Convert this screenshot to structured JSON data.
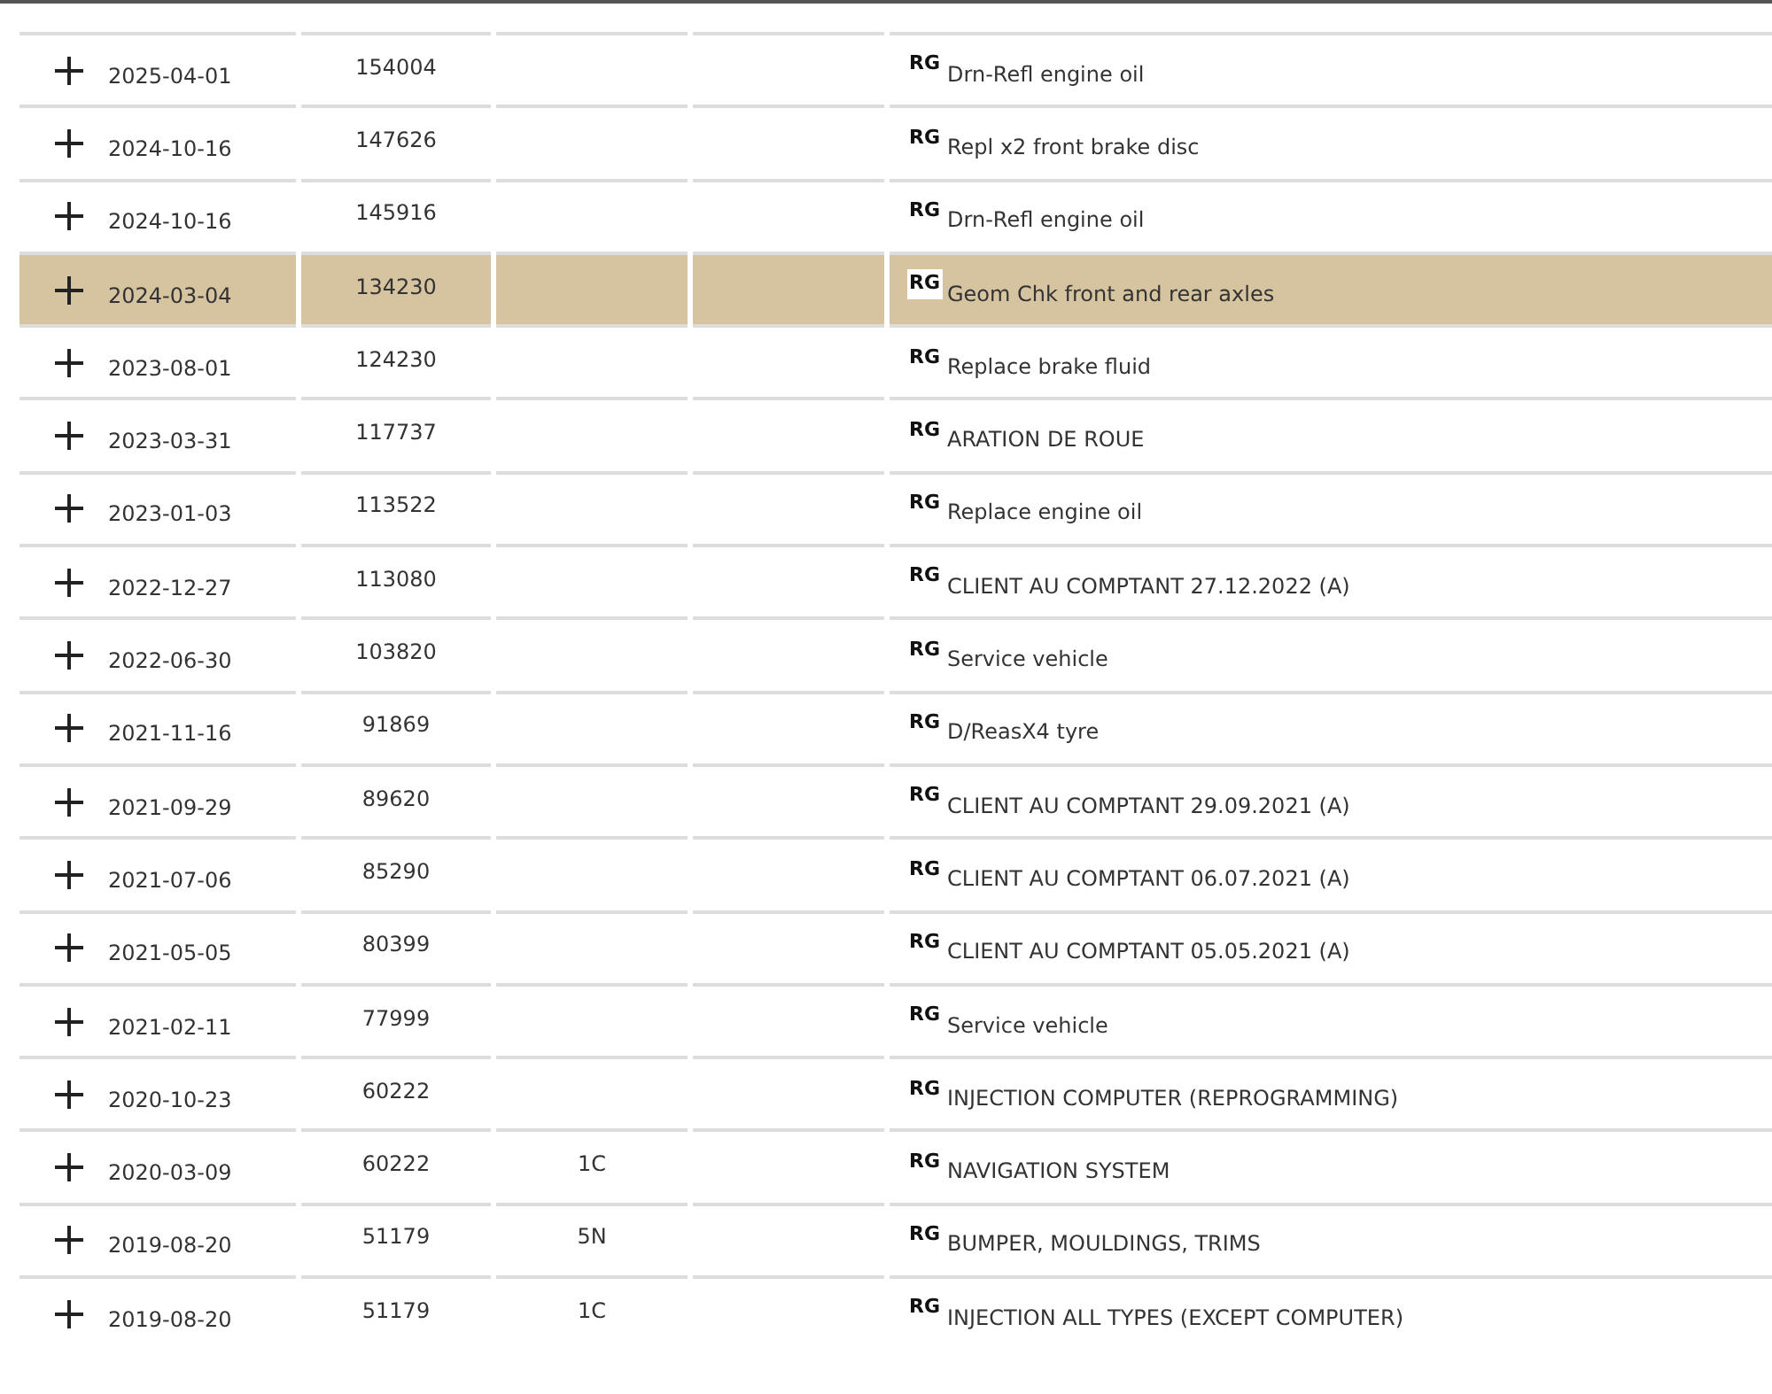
{
  "rows": [
    {
      "date": "2025-04-01",
      "column_2": "154004",
      "tag": "RG",
      "description": "Drn-Refl engine oil",
      "selected": false
    },
    {
      "date": "2024-10-16",
      "column_2": "147626",
      "tag": "RG",
      "description": "Repl x2 front brake disc",
      "selected": false
    },
    {
      "date": "2024-10-16",
      "column_2": "145916",
      "tag": "RG",
      "description": "Drn-Refl engine oil",
      "selected": false
    },
    {
      "date": "2024-03-04",
      "column_2": "134230",
      "tag": "RG",
      "description": "Geom Chk front and rear axles",
      "selected": true
    },
    {
      "date": "2023-08-01",
      "column_2": "124230",
      "tag": "RG",
      "description": "Replace brake fluid",
      "selected": false
    },
    {
      "date": "2023-03-31",
      "column_2": "117737",
      "tag": "RG",
      "description": "ARATION DE ROUE",
      "selected": false
    },
    {
      "date": "2023-01-03",
      "column_2": "113522",
      "tag": "RG",
      "description": "Replace engine oil",
      "selected": false
    },
    {
      "date": "2022-12-27",
      "column_2": "113080",
      "tag": "RG",
      "description": "CLIENT AU COMPTANT 27.12.2022 (A)",
      "selected": false
    },
    {
      "date": "2022-06-30",
      "column_2": "103820",
      "tag": "RG",
      "description": "Service vehicle",
      "selected": false
    },
    {
      "date": "2021-11-16",
      "column_2": "91869",
      "tag": "RG",
      "description": "D/ReasX4 tyre",
      "selected": false
    },
    {
      "date": "2021-09-29",
      "column_2": "89620",
      "tag": "RG",
      "description": "CLIENT AU COMPTANT 29.09.2021 (A)",
      "selected": false
    },
    {
      "date": "2021-07-06",
      "column_2": "85290",
      "tag": "RG",
      "description": "CLIENT AU COMPTANT 06.07.2021 (A)",
      "selected": false
    },
    {
      "date": "2021-05-05",
      "column_2": "80399",
      "tag": "RG",
      "description": "CLIENT AU COMPTANT 05.05.2021 (A)",
      "selected": false
    },
    {
      "date": "2021-02-11",
      "column_2": "77999",
      "tag": "RG",
      "description": "Service vehicle",
      "selected": false
    },
    {
      "date": "2020-10-23",
      "column_2": "60222",
      "tag": "RG",
      "description": "INJECTION COMPUTER (REPROGRAMMING)",
      "selected": false
    },
    {
      "date": "2020-03-09",
      "column_2": "60222",
      "column_3": "1C",
      "tag": "RG",
      "description": "NAVIGATION SYSTEM",
      "selected": false
    },
    {
      "date": "2019-08-20",
      "column_2": "51179",
      "column_3": "5N",
      "tag": "RG",
      "description": "BUMPER, MOULDINGS, TRIMS",
      "selected": false
    },
    {
      "date": "2019-08-20",
      "column_2": "51179",
      "column_3": "1C",
      "tag": "RG",
      "description": "INJECTION ALL TYPES (EXCEPT COMPUTER)",
      "selected": false
    }
  ]
}
